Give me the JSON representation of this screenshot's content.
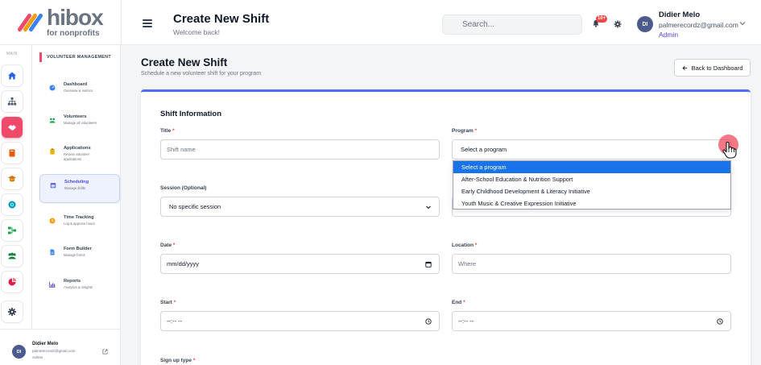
{
  "brand": {
    "word": "hibox",
    "sub": "for nonprofits"
  },
  "header": {
    "title": "Create New Shift",
    "subtitle": "Welcome back!",
    "notification_count": "10+"
  },
  "search": {
    "placeholder": "Search..."
  },
  "user": {
    "initials": "DI",
    "name": "Didier Melo",
    "email": "palmerecordz@gmail.com",
    "role": "Admin"
  },
  "rail": {
    "title": "MAIN"
  },
  "nav": {
    "section": "VOLUNTEER MANAGEMENT",
    "items": [
      {
        "label": "Dashboard",
        "desc": "Overview & metrics",
        "icon": "dashboard-icon"
      },
      {
        "label": "Volunteers",
        "desc": "Manage all volunteers",
        "icon": "users-icon"
      },
      {
        "label": "Applications",
        "desc": "Review volunteer applications",
        "icon": "clipboard-icon"
      },
      {
        "label": "Scheduling",
        "desc": "Manage shifts",
        "icon": "calendar-icon"
      },
      {
        "label": "Time Tracking",
        "desc": "Log & approve hours",
        "icon": "clock-icon"
      },
      {
        "label": "Form Builder",
        "desc": "Manage forms",
        "icon": "form-icon"
      },
      {
        "label": "Reports",
        "desc": "Analytics & insights",
        "icon": "chart-icon"
      }
    ]
  },
  "page": {
    "title": "Create New Shift",
    "subtitle": "Schedule a new volunteer shift for your program",
    "back_label": "Back to Dashboard"
  },
  "form": {
    "section_title": "Shift Information",
    "title": {
      "label": "Title",
      "required": "*",
      "placeholder": "Shift name"
    },
    "program": {
      "label": "Program",
      "required": "*",
      "value": "Select a program",
      "options": [
        "Select a program",
        "After-School Education & Nutrition Support",
        "Early Childhood Development & Literacy Initiative",
        "Youth Music & Creative Expression Initiative"
      ]
    },
    "session": {
      "label": "Session (Optional)",
      "value": "No specific session"
    },
    "date": {
      "label": "Date",
      "required": "*",
      "value": "mm/dd/yyyy"
    },
    "location": {
      "label": "Location",
      "required": "*",
      "placeholder": "Where"
    },
    "start": {
      "label": "Start",
      "required": "*",
      "value": "--:-- --"
    },
    "end": {
      "label": "End",
      "required": "*",
      "value": "--:-- --"
    },
    "signup_type": {
      "label": "Sign up type",
      "required": "*"
    }
  },
  "colors": {
    "accent": "#ef4a6c",
    "primary": "#4f46e5",
    "card_border": "#4f6ef2",
    "selected_option": "#1a73e8"
  }
}
